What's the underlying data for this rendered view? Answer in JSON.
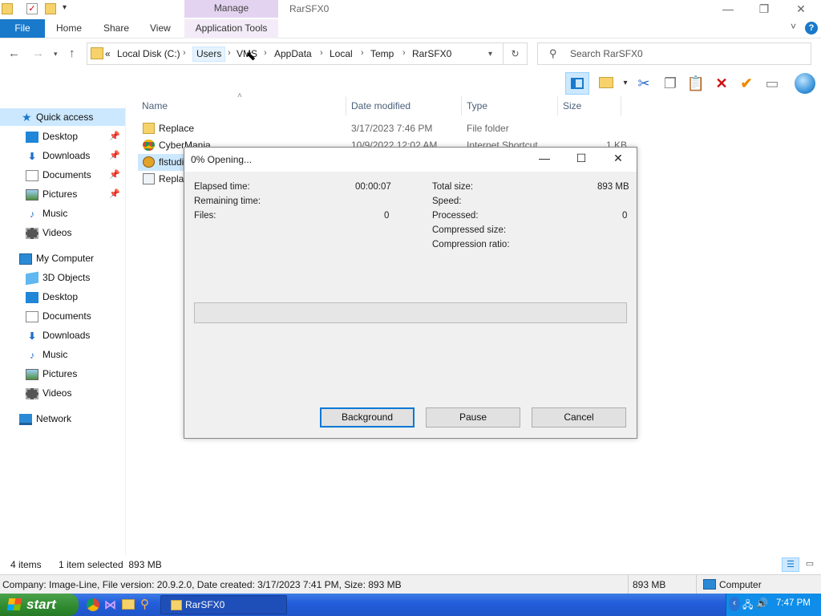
{
  "window": {
    "title": "RarSFX0",
    "manage_tab": "Manage",
    "controls": {
      "minimize": "—",
      "maximize": "❐",
      "close": "✕"
    }
  },
  "ribbon": {
    "tabs": [
      "File",
      "Home",
      "Share",
      "View",
      "Application Tools"
    ],
    "help": "?",
    "expand": "˅"
  },
  "address": {
    "overflow": "«",
    "crumbs": [
      "Local Disk (C:)",
      "Users",
      "VMS",
      "AppData",
      "Local",
      "Temp",
      "RarSFX0"
    ],
    "search_placeholder": "Search RarSFX0"
  },
  "nav": {
    "quick_access": "Quick access",
    "quick_items": [
      "Desktop",
      "Downloads",
      "Documents",
      "Pictures",
      "Music",
      "Videos"
    ],
    "my_computer": "My Computer",
    "computer_items": [
      "3D Objects",
      "Desktop",
      "Documents",
      "Downloads",
      "Music",
      "Pictures",
      "Videos"
    ],
    "network": "Network"
  },
  "columns": {
    "name": "Name",
    "date": "Date modified",
    "type": "Type",
    "size": "Size"
  },
  "files": [
    {
      "name": "Replace",
      "date": "3/17/2023 7:46 PM",
      "type": "File folder",
      "size": ""
    },
    {
      "name": "CyberMania",
      "date": "10/9/2022 12:02 AM",
      "type": "Internet Shortcut",
      "size": "1 KB"
    },
    {
      "name": "flstudi",
      "date": "",
      "type": "",
      "size": ""
    },
    {
      "name": "Replac",
      "date": "",
      "type": "",
      "size": ""
    }
  ],
  "dialog": {
    "title": "0% Opening...",
    "elapsed_label": "Elapsed time:",
    "elapsed_value": "00:00:07",
    "remaining_label": "Remaining time:",
    "files_label": "Files:",
    "files_value": "0",
    "total_size_label": "Total size:",
    "total_size_value": "893 MB",
    "speed_label": "Speed:",
    "processed_label": "Processed:",
    "processed_value": "0",
    "compressed_label": "Compressed size:",
    "ratio_label": "Compression ratio:",
    "progress_fraction": 0,
    "buttons": {
      "background": "Background",
      "pause": "Pause",
      "cancel": "Cancel"
    }
  },
  "status": {
    "items": "4 items",
    "selected": "1 item selected  893 MB"
  },
  "details": {
    "text": "Company: Image-Line, File version: 20.9.2.0, Date created: 3/17/2023 7:41 PM, Size: 893 MB",
    "size": "893 MB",
    "location": "Computer"
  },
  "taskbar": {
    "start": "start",
    "task": "RarSFX0",
    "clock": "7:47 PM"
  },
  "colors": {
    "accent": "#1979ca",
    "manage": "#e3d3f0",
    "selection": "#cce8ff",
    "taskbar": "#245edb",
    "start": "#2f8a2f",
    "progress": "#06b025"
  }
}
